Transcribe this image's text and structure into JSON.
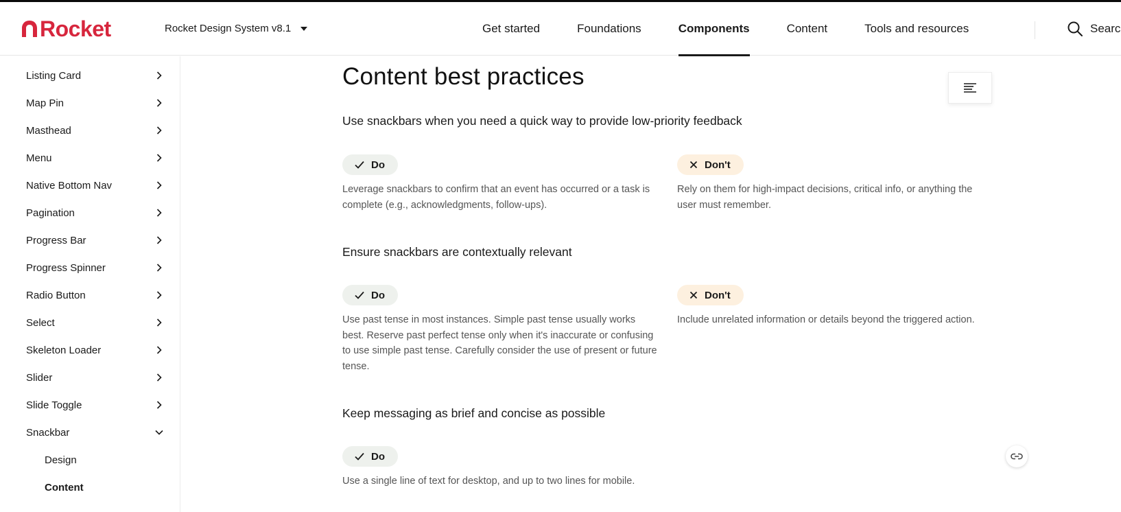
{
  "brand": {
    "logo_text": "Rocket",
    "color": "#d7263d"
  },
  "header": {
    "version_label": "Rocket Design System v8.1",
    "nav": [
      "Get started",
      "Foundations",
      "Components",
      "Content",
      "Tools and resources"
    ],
    "active_nav": "Components",
    "search_label": "Searc"
  },
  "sidebar": {
    "items": [
      "Listing Card",
      "Map Pin",
      "Masthead",
      "Menu",
      "Native Bottom Nav",
      "Pagination",
      "Progress Bar",
      "Progress Spinner",
      "Radio Button",
      "Select",
      "Skeleton Loader",
      "Slider",
      "Slide Toggle",
      "Snackbar"
    ],
    "expanded_item": "Snackbar",
    "sub_items": [
      "Design",
      "Content"
    ],
    "active_sub": "Content"
  },
  "main": {
    "title": "Content best practices",
    "sections": [
      {
        "heading": "Use snackbars when you need a quick way to provide low-priority feedback",
        "do_label": "Do",
        "do_text": "Leverage snackbars to confirm that an event has occurred or a task is complete (e.g., acknowledgments, follow-ups).",
        "dont_label": "Don't",
        "dont_text": "Rely on them for high-impact decisions, critical info, or anything the user must remember."
      },
      {
        "heading": "Ensure snackbars are contextually relevant",
        "do_label": "Do",
        "do_text": "Use past tense in most instances. Simple past tense usually works best. Reserve past perfect tense only when it's inaccurate or confusing to use simple past tense. Carefully consider the use of present or future tense.",
        "dont_label": "Don't",
        "dont_text": "Include unrelated information or details beyond the triggered action."
      },
      {
        "heading": "Keep messaging as brief and concise as possible",
        "do_label": "Do",
        "do_text": "Use a single line of text for desktop, and up to two lines for mobile."
      }
    ]
  },
  "icons": {
    "search": "search-icon",
    "toc": "table-of-contents-icon",
    "link": "link-icon",
    "check": "check-icon",
    "close": "close-icon",
    "chevron_right": "chevron-right-icon",
    "chevron_down": "chevron-down-icon"
  },
  "colors": {
    "do_pill": "#eef1ed",
    "dont_pill": "#fdf0df",
    "text_muted": "#555555"
  }
}
